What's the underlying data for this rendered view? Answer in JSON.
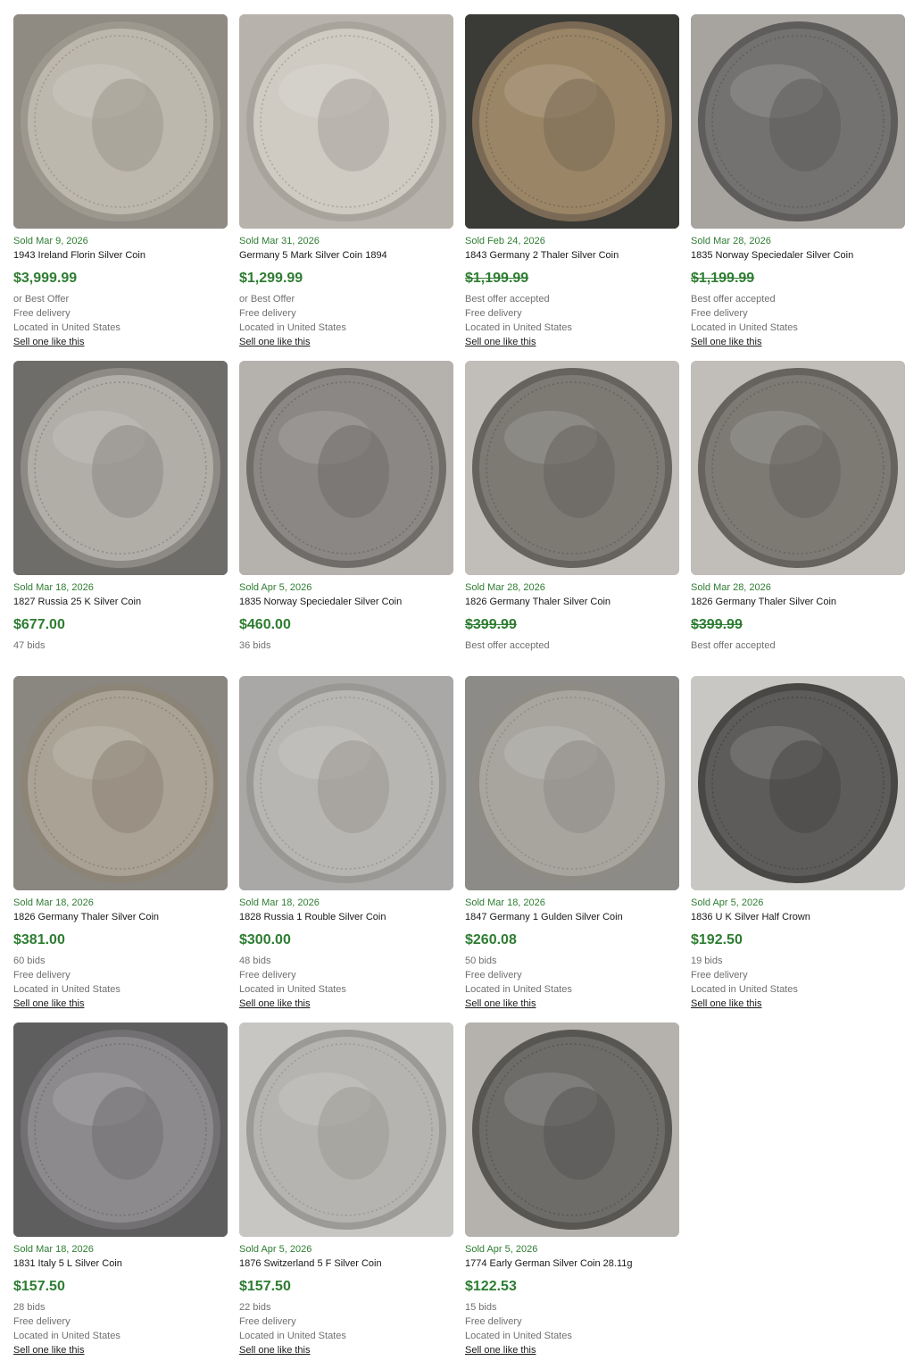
{
  "listings": [
    {
      "sold": "Sold Mar 9, 2026",
      "title": "1943 Ireland Florin Silver Coin",
      "price": "$3,999.99",
      "strike": false,
      "lines": [
        "or Best Offer",
        "Free delivery",
        "Located in United States"
      ],
      "sell": "Sell one like this",
      "bg": "#8f8a82",
      "coin": "#bdb8ae",
      "rim": "#9d988e",
      "icon": "salmon-florin-coin-icon"
    },
    {
      "sold": "Sold Mar 31, 2026",
      "title": "Germany 5 Mark Silver Coin 1894",
      "price": "$1,299.99",
      "strike": false,
      "lines": [
        "or Best Offer",
        "Free delivery",
        "Located in United States"
      ],
      "sell": "Sell one like this",
      "bg": "#b7b3ac",
      "coin": "#cfcbc3",
      "rim": "#a8a49c",
      "icon": "bird-of-paradise-coin-icon"
    },
    {
      "sold": "Sold Feb 24, 2026",
      "title": "1843 Germany 2 Thaler Silver Coin",
      "price": "$1,199.99",
      "strike": true,
      "lines": [
        "Best offer accepted",
        "Free delivery",
        "Located in United States"
      ],
      "sell": "Sell one like this",
      "bg": "#3a3a36",
      "coin": "#9a8566",
      "rim": "#7a6a55",
      "icon": "portrait-thaler-coin-icon"
    },
    {
      "sold": "Sold Mar 28, 2026",
      "title": "1835 Norway Speciedaler Silver Coin",
      "price": "$1,199.99",
      "strike": true,
      "lines": [
        "Best offer accepted",
        "Free delivery",
        "Located in United States"
      ],
      "sell": "Sell one like this",
      "bg": "#a7a4a0",
      "coin": "#737270",
      "rim": "#5e5d5b",
      "icon": "portrait-speciedaler-coin-icon"
    },
    {
      "sold": "Sold Mar 18, 2026",
      "title": "1827 Russia 25 K Silver Coin",
      "price": "$677.00",
      "strike": false,
      "lines": [
        "47 bids"
      ],
      "sell": "",
      "bg": "#6f6d6a",
      "coin": "#b1aea8",
      "rim": "#8d8a85",
      "icon": "crown-25-kopek-coin-icon"
    },
    {
      "sold": "Sold Apr 5, 2026",
      "title": "1835 Norway Speciedaler Silver Coin",
      "price": "$460.00",
      "strike": false,
      "lines": [
        "36 bids"
      ],
      "sell": "",
      "bg": "#b5b2ad",
      "coin": "#8a8784",
      "rim": "#6f6c69",
      "icon": "portrait-speciedaler-coin-icon"
    },
    {
      "sold": "Sold Mar 28, 2026",
      "title": "1826 Germany Thaler Silver Coin",
      "price": "$399.99",
      "strike": true,
      "lines": [
        "Best offer accepted"
      ],
      "sell": "",
      "bg": "#c1beba",
      "coin": "#7d7a74",
      "rim": "#66635e",
      "icon": "ludwig-portrait-coin-icon"
    },
    {
      "sold": "Sold Mar 28, 2026",
      "title": "1826 Germany Thaler Silver Coin",
      "price": "$399.99",
      "strike": true,
      "lines": [
        "Best offer accepted"
      ],
      "sell": "",
      "bg": "#c1beba",
      "coin": "#7d7a74",
      "rim": "#66635e",
      "icon": "ludwig-portrait-coin-icon"
    },
    {
      "sold": "Sold Mar 18, 2026",
      "title": "1826 Germany Thaler Silver Coin",
      "price": "$381.00",
      "strike": false,
      "lines": [
        "60 bids",
        "Free delivery",
        "Located in United States"
      ],
      "sell": "Sell one like this",
      "bg": "#8a8680",
      "coin": "#aaa295",
      "rim": "#8c8477",
      "icon": "double-portrait-coin-icon"
    },
    {
      "sold": "Sold Mar 18, 2026",
      "title": "1828 Russia 1 Rouble Silver Coin",
      "price": "$300.00",
      "strike": false,
      "lines": [
        "48 bids",
        "Free delivery",
        "Located in United States"
      ],
      "sell": "Sell one like this",
      "bg": "#a9a8a6",
      "coin": "#b8b6b2",
      "rim": "#9a9894",
      "icon": "eagle-rouble-coin-icon"
    },
    {
      "sold": "Sold Mar 18, 2026",
      "title": "1847 Germany 1 Gulden Silver Coin",
      "price": "$260.08",
      "strike": false,
      "lines": [
        "50 bids",
        "Free delivery",
        "Located in United States"
      ],
      "sell": "Sell one like this",
      "bg": "#8c8b88",
      "coin": "#a8a59f",
      "rim": "#8e8b85",
      "icon": "portrait-gulden-coin-icon"
    },
    {
      "sold": "Sold Apr 5, 2026",
      "title": "1836 U K Silver Half Crown",
      "price": "$192.50",
      "strike": false,
      "lines": [
        "19 bids",
        "Free delivery",
        "Located in United States"
      ],
      "sell": "Sell one like this",
      "bg": "#c9c7c4",
      "coin": "#5d5c5a",
      "rim": "#484745",
      "icon": "portrait-half-crown-coin-icon"
    },
    {
      "sold": "Sold Mar 18, 2026",
      "title": "1831 Italy 5 L Silver Coin",
      "price": "$157.50",
      "strike": false,
      "lines": [
        "28 bids",
        "Free delivery",
        "Located in United States"
      ],
      "sell": "Sell one like this",
      "bg": "#5e5e5f",
      "coin": "#8c8a8c",
      "rim": "#727072",
      "icon": "papal-portrait-coin-icon"
    },
    {
      "sold": "Sold Apr 5, 2026",
      "title": "1876 Switzerland 5 F Silver Coin",
      "price": "$157.50",
      "strike": false,
      "lines": [
        "22 bids",
        "Free delivery",
        "Located in United States"
      ],
      "sell": "Sell one like this",
      "bg": "#c7c6c3",
      "coin": "#b6b4b0",
      "rim": "#9c9a96",
      "icon": "shooting-festival-coin-icon"
    },
    {
      "sold": "Sold Apr 5, 2026",
      "title": "1774 Early German Silver Coin 28.11g",
      "price": "$122.53",
      "strike": false,
      "lines": [
        "15 bids",
        "Free delivery",
        "Located in United States"
      ],
      "sell": "Sell one like this",
      "bg": "#b5b2ad",
      "coin": "#6e6c69",
      "rim": "#585653",
      "icon": "saxony-portrait-coin-icon"
    }
  ]
}
